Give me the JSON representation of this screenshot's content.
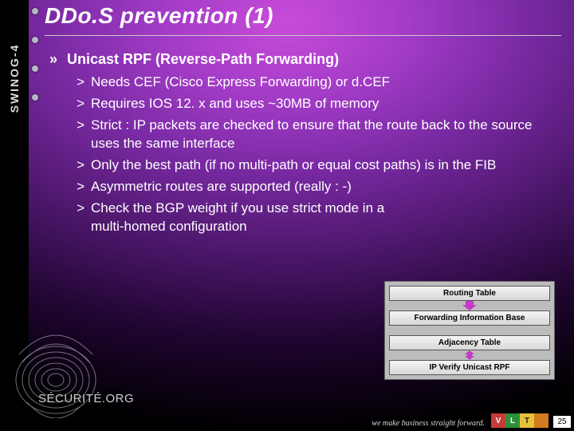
{
  "rail": {
    "brand": "SWINOG-4"
  },
  "title": "DDo.S prevention (1)",
  "bullet": {
    "marker": "»",
    "text": "Unicast RPF (Reverse-Path Forwarding)",
    "sub_marker": ">",
    "subs": [
      "Needs CEF (Cisco Express Forwarding) or d.CEF",
      "Requires IOS 12. x and uses ~30MB of memory",
      "Strict : IP packets are checked to ensure that the route back to the source uses the same interface",
      "Only the best path (if no multi-path or equal cost paths) is in the FIB",
      "Asymmetric routes are supported (really : -)",
      "Check the BGP weight if you use strict mode in a multi-homed configuration"
    ]
  },
  "diagram": {
    "boxes": [
      "Routing Table",
      "Forwarding Information Base",
      "Adjacency Table",
      "IP Verify Unicast RPF"
    ],
    "arrow_colors": {
      "down": "#c63ac6",
      "bi": "#c63ac6"
    }
  },
  "logo": {
    "text": "SÉCURITÉ.ORG"
  },
  "footer": {
    "slogan": "we make business straight forward.",
    "badges": [
      "V",
      "L",
      "T",
      ""
    ],
    "page": "25"
  }
}
